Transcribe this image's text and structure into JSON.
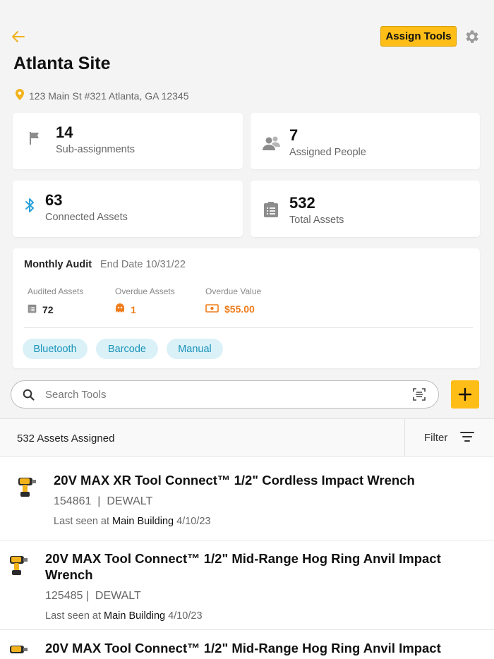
{
  "header": {
    "assign_label": "Assign Tools",
    "title": "Atlanta Site",
    "address": "123 Main St #321 Atlanta, GA 12345"
  },
  "stats": [
    {
      "value": "14",
      "label": "Sub-assignments",
      "icon": "flag-icon"
    },
    {
      "value": "7",
      "label": "Assigned People",
      "icon": "people-icon"
    },
    {
      "value": "63",
      "label": "Connected Assets",
      "icon": "bluetooth-icon"
    },
    {
      "value": "532",
      "label": "Total Assets",
      "icon": "clipboard-icon"
    }
  ],
  "audit": {
    "title": "Monthly Audit",
    "end_date": "End Date 10/31/22",
    "metrics": [
      {
        "label": "Audited Assets",
        "value": "72",
        "icon": "clipboard-icon"
      },
      {
        "label": "Overdue Assets",
        "value": "1",
        "icon": "ghost-icon"
      },
      {
        "label": "Overdue Value",
        "value": "$55.00",
        "icon": "money-icon"
      }
    ],
    "chips": [
      "Bluetooth",
      "Barcode",
      "Manual"
    ]
  },
  "search": {
    "placeholder": "Search Tools"
  },
  "list_header": {
    "count_label": "532 Assets Assigned",
    "filter_label": "Filter"
  },
  "tools": [
    {
      "name_line1": "20V MAX XR Tool Connect™ 1/2\" Cordless Impact Wrench",
      "name_line2": "",
      "id": "154861",
      "sep": "|",
      "brand": "DEWALT",
      "seen_prefix": "Last seen at",
      "location": "Main Building",
      "date": "4/10/23"
    },
    {
      "name_line1": "20V MAX Tool Connect™ 1/2\" Mid-Range Hog Ring Anvil Impact",
      "name_line2": "Wrench",
      "id": "125485",
      "sep": "|",
      "brand": "DEWALT",
      "seen_prefix": "Last seen at",
      "location": "Main Building",
      "date": "4/10/23"
    },
    {
      "name_line1": "20V MAX Tool Connect™ 1/2\" Mid-Range Hog Ring Anvil Impact",
      "name_line2": "",
      "id": "",
      "sep": "",
      "brand": "",
      "seen_prefix": "",
      "location": "",
      "date": ""
    }
  ],
  "colors": {
    "accent": "#febd17",
    "orange": "#f07d1c",
    "chip_bg": "#daf1f8",
    "chip_text": "#1a93b8",
    "bluetooth": "#2aa1d8"
  }
}
